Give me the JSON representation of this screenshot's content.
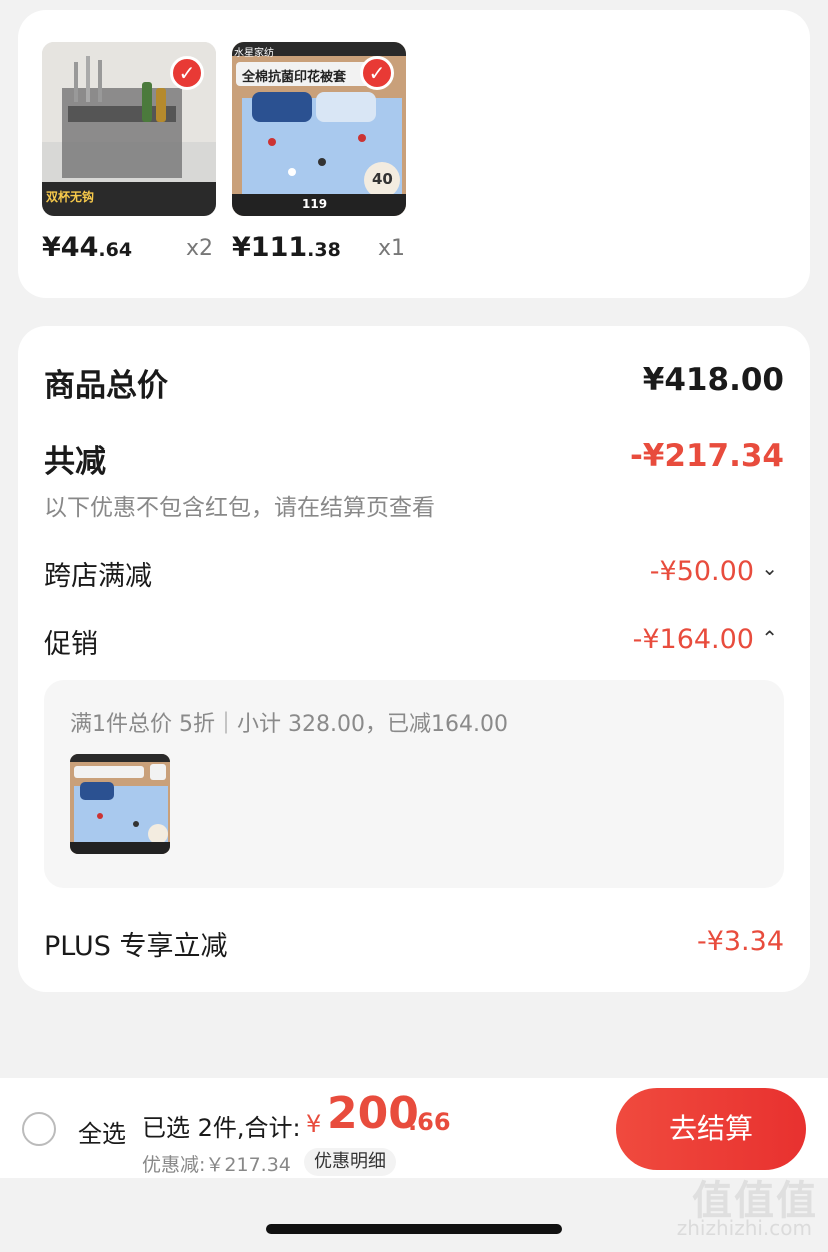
{
  "items": [
    {
      "price_int": "¥44",
      "price_dec": ".64",
      "qty": "x2"
    },
    {
      "price_int": "¥111",
      "price_dec": ".38",
      "qty": "x1"
    }
  ],
  "product_texts": {
    "rack_badge": "双杯无钩",
    "bedding_title": "全棉抗菌印花被套",
    "bedding_brand": "水星家纺",
    "bedding_badge": "40",
    "bedding_price": "119"
  },
  "summary": {
    "total_label": "商品总价",
    "total_value": "¥418.00",
    "reduce_label": "共减",
    "reduce_value": "-¥217.34",
    "reduce_note": "以下优惠不包含红包，请在结算页查看",
    "cross_label": "跨店满减",
    "cross_value": "-¥50.00",
    "promo_label": "促销",
    "promo_value": "-¥164.00",
    "promo_detail": "满1件总价 5折｜小计 328.00，已减164.00",
    "plus_label": "PLUS 专享立减",
    "plus_value": "-¥3.34"
  },
  "bottom": {
    "select_all": "全选",
    "selected": "已选 2件,合计:",
    "total_symbol": "¥",
    "total_int": "200",
    "total_dec": ".66",
    "discount": "优惠减:￥217.34",
    "detail_button": "优惠明细",
    "checkout_button": "去结算"
  },
  "watermark": {
    "logo": "值值值",
    "url": "zhizhizhi.com"
  },
  "colors": {
    "accent": "#e84c3d",
    "checkout": "#ef4136"
  }
}
